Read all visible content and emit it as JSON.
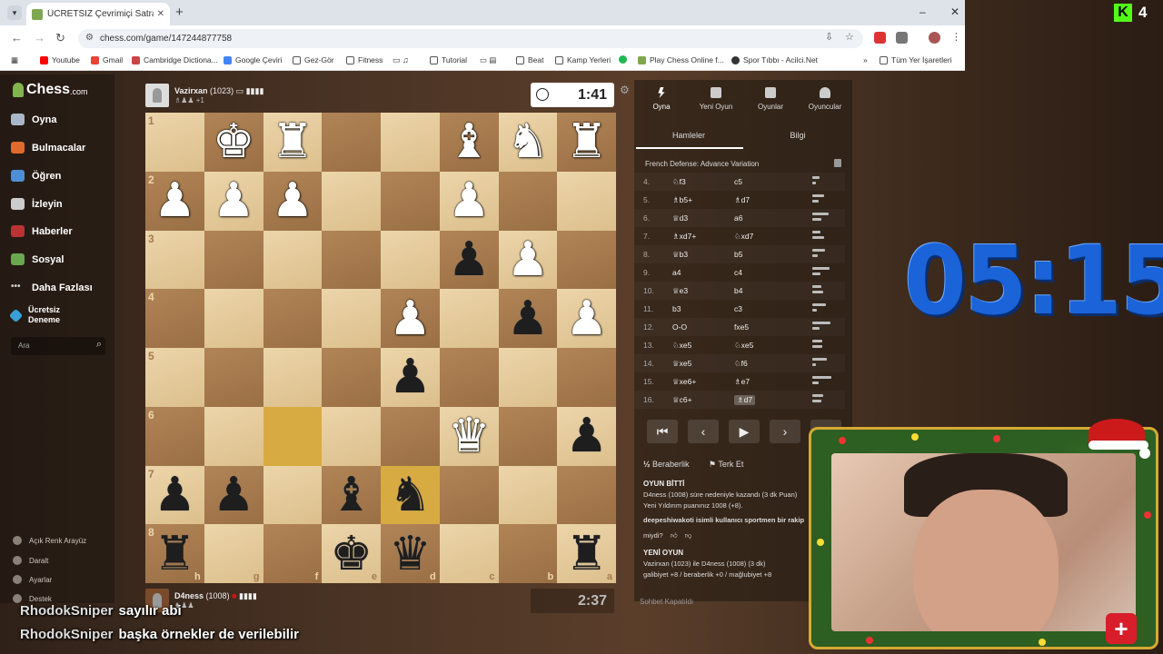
{
  "browser": {
    "tab_title": "ÜCRETSİZ Çevrimiçi Satranç...",
    "url": "chess.com/game/147244877758",
    "bookmarks": [
      "Youtube",
      "Gmail",
      "Cambridge Dictiona...",
      "Google Çeviri",
      "Gez-Gör",
      "Fitness",
      "Tutorial",
      "Beat",
      "Kamp Yerleri",
      "Play Chess Online f...",
      "Spor Tıbbı - Acilci.Net",
      "Tüm Yer İşaretleri"
    ]
  },
  "sidebar": {
    "logo": "Chess",
    "logo_suffix": ".com",
    "items": [
      "Oyna",
      "Bulmacalar",
      "Öğren",
      "İzleyin",
      "Haberler",
      "Sosyal",
      "Daha Fazlası",
      "Ücretsiz Deneme"
    ],
    "search_placeholder": "Ara",
    "footer": [
      "Açık Renk Arayüz",
      "Daralt",
      "Ayarlar",
      "Destek"
    ]
  },
  "top_player": {
    "name": "Vazirxan",
    "rating": "(1023)",
    "captured": "+1",
    "clock": "1:41"
  },
  "bottom_player": {
    "name": "D4ness",
    "rating": "(1008)",
    "clock": "2:37"
  },
  "board": {
    "ranks": [
      "1",
      "2",
      "3",
      "4",
      "5",
      "6",
      "7",
      "8"
    ],
    "files": [
      "h",
      "g",
      "f",
      "e",
      "d",
      "c",
      "b",
      "a"
    ]
  },
  "right_panel": {
    "tabs": [
      "Oyna",
      "Yeni Oyun",
      "Oyunlar",
      "Oyuncular"
    ],
    "subtabs": [
      "Hamleler",
      "Bilgi"
    ],
    "opening": "French Defense: Advance Variation",
    "moves": [
      {
        "n": "4.",
        "w": "♘f3",
        "b": "c5"
      },
      {
        "n": "5.",
        "w": "♗b5+",
        "b": "♗d7"
      },
      {
        "n": "6.",
        "w": "♕d3",
        "b": "a6"
      },
      {
        "n": "7.",
        "w": "♗xd7+",
        "b": "♘xd7"
      },
      {
        "n": "8.",
        "w": "♕b3",
        "b": "b5"
      },
      {
        "n": "9.",
        "w": "a4",
        "b": "c4"
      },
      {
        "n": "10.",
        "w": "♕e3",
        "b": "b4"
      },
      {
        "n": "11.",
        "w": "b3",
        "b": "c3"
      },
      {
        "n": "12.",
        "w": "O-O",
        "b": "fxe5"
      },
      {
        "n": "13.",
        "w": "♘xe5",
        "b": "♘xe5"
      },
      {
        "n": "14.",
        "w": "♕xe5",
        "b": "♘f6"
      },
      {
        "n": "15.",
        "w": "♕xe6+",
        "b": "♗e7"
      },
      {
        "n": "16.",
        "w": "♕c6+",
        "b": "♗d7"
      }
    ],
    "draw": "Beraberlik",
    "resign": "Terk Et",
    "game_over": "OYUN BİTTİ",
    "result_line1": "D4ness (1008) süre nedeniyle kazandı (3 dk Puan)",
    "result_line2": "Yeni Yıldırım puanınız 1008 (+8).",
    "report_line": "deepeshiwakoti isimli kullanıcı sportmen bir rakip",
    "question": "miydi?",
    "new_game_header": "YENİ OYUN",
    "new_game_line1": "Vazirxan (1023) ile D4ness (1008) (3 dk)",
    "new_game_line2": "galibiyet +8 / beraberlik +0 / mağlubiyet +8",
    "chat_off": "Sohbet Kapatıldı"
  },
  "overlay": {
    "timer": "05:15",
    "viewers": "4",
    "kick_logo": "K"
  },
  "chat": [
    {
      "user": "RhodokSniper",
      "msg": "sayılır abi"
    },
    {
      "user": "RhodokSniper",
      "msg": "başka örnekler de verilebilir"
    }
  ]
}
